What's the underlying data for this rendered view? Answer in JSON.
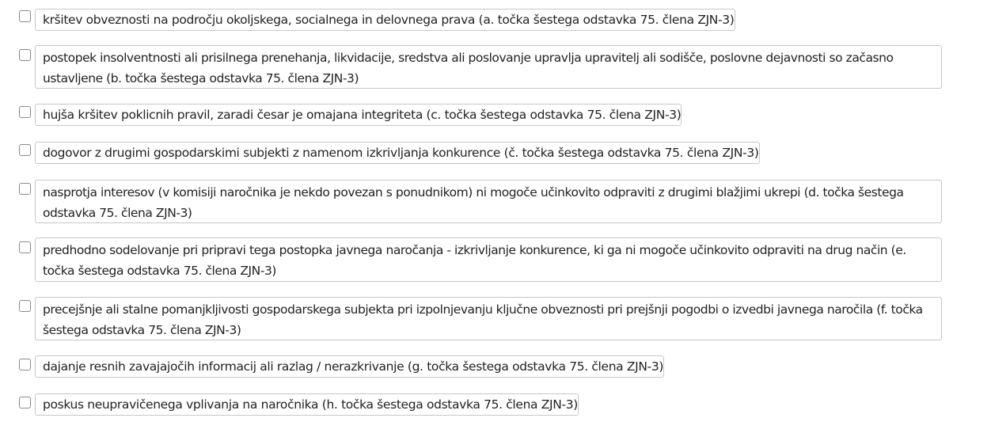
{
  "options": [
    {
      "label": "kršitev obveznosti na področju okoljskega, socialnega in delovnega prava (a. točka šestega odstavka 75. člena ZJN-3)",
      "checked": false
    },
    {
      "label": "postopek insolventnosti ali prisilnega prenehanja, likvidacije, sredstva ali poslovanje upravlja upravitelj ali sodišče, poslovne dejavnosti so začasno ustavljene (b. točka šestega odstavka 75. člena ZJN-3)",
      "checked": false
    },
    {
      "label": "hujša kršitev poklicnih pravil, zaradi česar je omajana integriteta (c. točka šestega odstavka 75. člena ZJN-3)",
      "checked": false
    },
    {
      "label": "dogovor z drugimi gospodarskimi subjekti z namenom izkrivljanja konkurence (č. točka šestega odstavka 75. člena ZJN-3)",
      "checked": false
    },
    {
      "label": "nasprotja interesov (v komisiji naročnika je nekdo povezan s ponudnikom) ni mogoče učinkovito odpraviti z drugimi blažjimi ukrepi (d. točka šestega odstavka 75. člena ZJN-3)",
      "checked": false
    },
    {
      "label": "predhodno sodelovanje pri pripravi tega postopka javnega naročanja - izkrivljanje konkurence, ki ga ni mogoče učinkovito odpraviti na drug način (e. točka šestega odstavka 75. člena ZJN-3)",
      "checked": false
    },
    {
      "label": "precejšnje ali stalne pomanjkljivosti gospodarskega subjekta pri izpolnjevanju ključne obveznosti pri prejšnji pogodbi o izvedbi javnega naročila (f. točka šestega odstavka 75. člena ZJN-3)",
      "checked": false
    },
    {
      "label": "dajanje resnih zavajajočih informacij ali razlag / nerazkrivanje (g. točka šestega odstavka 75. člena ZJN-3)",
      "checked": false
    },
    {
      "label": "poskus neupravičenega vplivanja na naročnika (h. točka šestega odstavka 75. člena ZJN-3)",
      "checked": false
    }
  ]
}
